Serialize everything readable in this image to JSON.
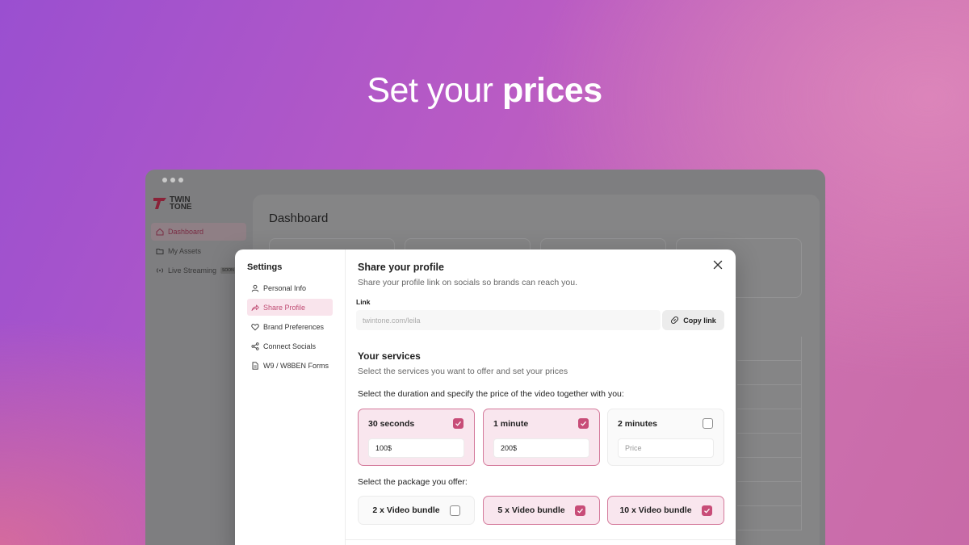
{
  "hero": {
    "title_regular": "Set your",
    "title_bold": "prices"
  },
  "app": {
    "logo_text_1": "TWIN",
    "logo_text_2": "TONE",
    "nav": [
      {
        "label": "Dashboard",
        "icon": "home-icon",
        "active": true
      },
      {
        "label": "My Assets",
        "icon": "folder-icon"
      },
      {
        "label": "Live Streaming",
        "icon": "broadcast-icon",
        "badge": "SOON"
      }
    ],
    "page_title": "Dashboard"
  },
  "modal": {
    "settings_title": "Settings",
    "menu": [
      {
        "label": "Personal Info",
        "icon": "user-icon"
      },
      {
        "label": "Share Profile",
        "icon": "share-icon",
        "active": true
      },
      {
        "label": "Brand Preferences",
        "icon": "heart-icon"
      },
      {
        "label": "Connect Socials",
        "icon": "connect-icon"
      },
      {
        "label": "W9 / W8BEN Forms",
        "icon": "document-icon"
      }
    ],
    "share_title": "Share your profile",
    "share_subtitle": "Share your profile link on socials so brands can reach you.",
    "link_label": "Link",
    "link_placeholder": "twintone.com/leila",
    "copy_button": "Copy link",
    "services_title": "Your services",
    "services_subtitle": "Select the services you want to offer and set your prices",
    "duration_instruction": "Select the duration and specify the price of the video together with you:",
    "durations": [
      {
        "label": "30 seconds",
        "checked": true,
        "price": "100$"
      },
      {
        "label": "1 minute",
        "checked": true,
        "price": "200$"
      },
      {
        "label": "2 minutes",
        "checked": false,
        "price": "",
        "placeholder": "Price"
      }
    ],
    "package_instruction": "Select the package you offer:",
    "packages": [
      {
        "label": "2 x Video bundle",
        "checked": false
      },
      {
        "label": "5 x Video bundle",
        "checked": true
      },
      {
        "label": "10 x Video bundle",
        "checked": true
      }
    ]
  },
  "colors": {
    "accent": "#c84d78",
    "accent_bg": "#f9e6ee",
    "accent_border": "#d47a9b"
  }
}
